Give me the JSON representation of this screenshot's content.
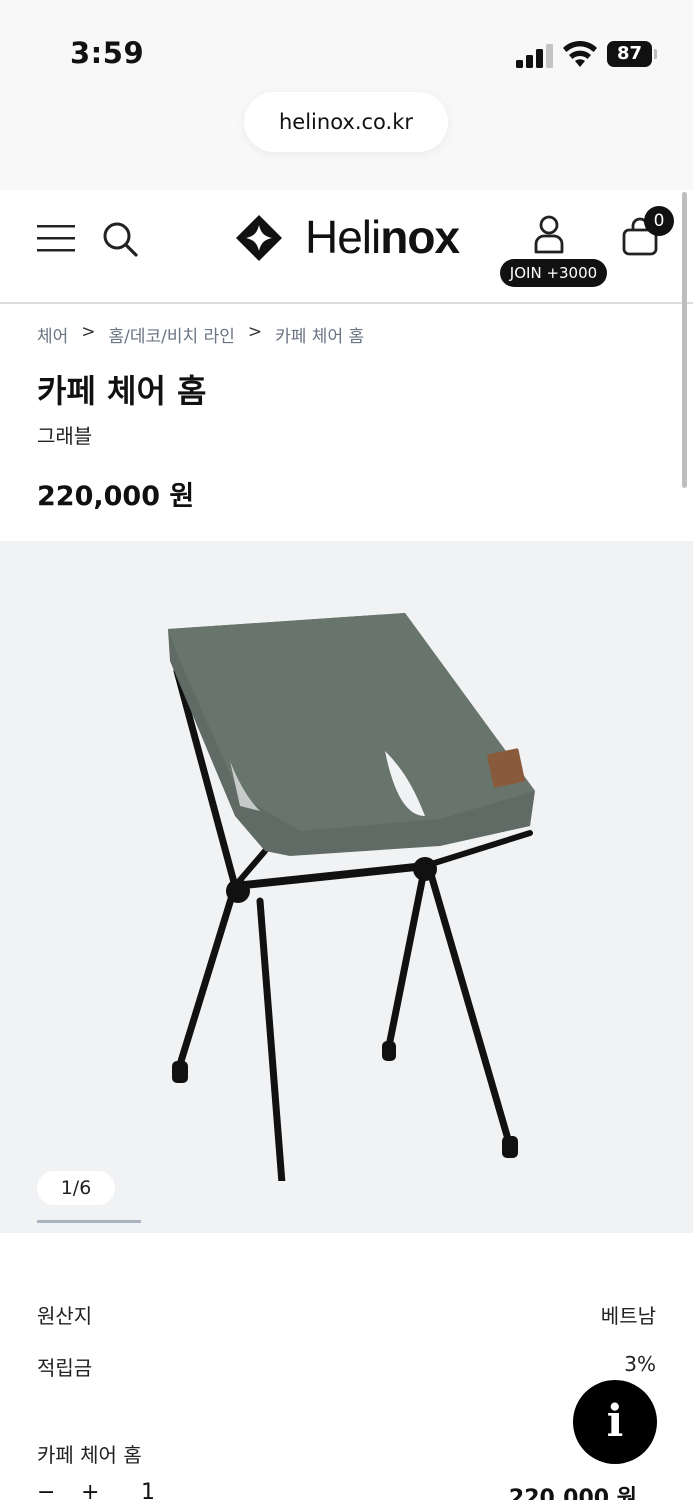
{
  "status_bar": {
    "time": "3:59",
    "battery": "87"
  },
  "browser": {
    "url": "helinox.co.kr"
  },
  "header": {
    "logo_regular": "Heli",
    "logo_bold": "nox",
    "join_badge": "JOIN +3000",
    "cart_count": "0"
  },
  "breadcrumb": [
    "체어",
    "홈/데코/비치 라인",
    "카페 체어 홈"
  ],
  "breadcrumb_separator": ">",
  "product": {
    "title": "카페 체어 홈",
    "variant": "그래블",
    "price": "220,000 원",
    "color_hex": "#5f6b64"
  },
  "gallery": {
    "current": "1",
    "total": "6",
    "indicator": "1/6"
  },
  "details": [
    {
      "label": "원산지",
      "value": "베트남"
    },
    {
      "label": "적립금",
      "value": "3%"
    }
  ],
  "order": {
    "option_name": "카페 체어 홈",
    "minus_label": "−",
    "plus_label": "+",
    "quantity": "1",
    "total": "220,000 원"
  },
  "fab": {
    "label": "i"
  }
}
